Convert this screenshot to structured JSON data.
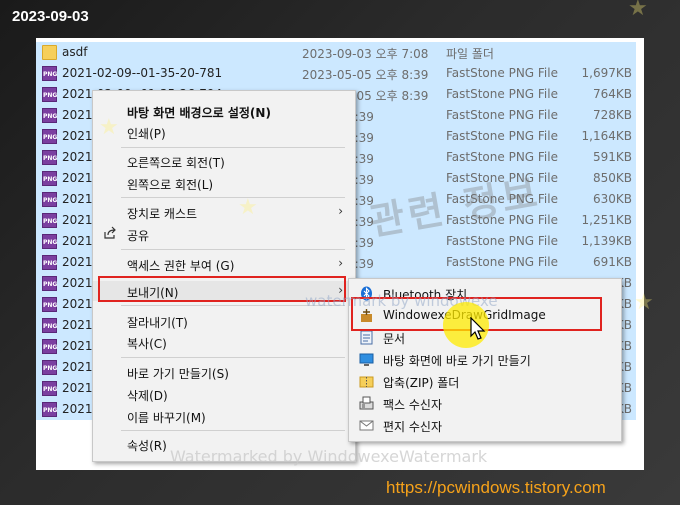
{
  "header_date": "2023-09-03",
  "url_text": "https://pcwindows.tistory.com",
  "watermark_big": "컴퓨터 관련 정보",
  "watermark_small": "watermark by windowexe",
  "watermark_bottom": "Watermarked by WindowexeWatermark",
  "files": [
    {
      "icon": "folder",
      "name": "asdf",
      "date": "2023-09-03 오후 7:08",
      "type": "파일 폴더",
      "size": ""
    },
    {
      "icon": "png",
      "name": "2021-02-09--01-35-20-781",
      "date": "2023-05-05 오후 8:39",
      "type": "FastStone PNG File",
      "size": "1,697KB"
    },
    {
      "icon": "png",
      "name": "2021-02-09--01-35-26-794",
      "date": "2023-05-05 오후 8:39",
      "type": "FastStone PNG File",
      "size": "764KB"
    },
    {
      "icon": "png",
      "name": "2021",
      "date": "05 오후 8:39",
      "type": "FastStone PNG File",
      "size": "728KB"
    },
    {
      "icon": "png",
      "name": "2021",
      "date": "05 오후 8:39",
      "type": "FastStone PNG File",
      "size": "1,164KB"
    },
    {
      "icon": "png",
      "name": "2021",
      "date": "05 오후 8:39",
      "type": "FastStone PNG File",
      "size": "591KB"
    },
    {
      "icon": "png",
      "name": "2021",
      "date": "05 오후 8:39",
      "type": "FastStone PNG File",
      "size": "850KB"
    },
    {
      "icon": "png",
      "name": "2021",
      "date": "05 오후 8:39",
      "type": "FastStone PNG File",
      "size": "630KB"
    },
    {
      "icon": "png",
      "name": "2021",
      "date": "05 오후 8:39",
      "type": "FastStone PNG File",
      "size": "1,251KB"
    },
    {
      "icon": "png",
      "name": "2021",
      "date": "05 오후 8:39",
      "type": "FastStone PNG File",
      "size": "1,139KB"
    },
    {
      "icon": "png",
      "name": "2021",
      "date": "05 오후 8:39",
      "type": "FastStone PNG File",
      "size": "691KB"
    },
    {
      "icon": "png",
      "name": "2021",
      "date": "",
      "type": "",
      "size": "KB"
    },
    {
      "icon": "png",
      "name": "2021",
      "date": "",
      "type": "",
      "size": "KB"
    },
    {
      "icon": "png",
      "name": "2021",
      "date": "",
      "type": "",
      "size": "KB"
    },
    {
      "icon": "png",
      "name": "2021",
      "date": "",
      "type": "",
      "size": "KB"
    },
    {
      "icon": "png",
      "name": "2021",
      "date": "",
      "type": "",
      "size": "KB"
    },
    {
      "icon": "png",
      "name": "2021",
      "date": "",
      "type": "",
      "size": "KB"
    },
    {
      "icon": "png",
      "name": "2021",
      "date": "",
      "type": "",
      "size": "KB"
    }
  ],
  "context_menu": {
    "set_background": "바탕 화면 배경으로 설정(N)",
    "print": "인쇄(P)",
    "rotate_right": "오른쪽으로 회전(T)",
    "rotate_left": "왼쪽으로 회전(L)",
    "cast_to_device": "장치로 캐스트",
    "share": "공유",
    "give_access": "액세스 권한 부여 (G)",
    "send_to": "보내기(N)",
    "cut": "잘라내기(T)",
    "copy": "복사(C)",
    "create_shortcut": "바로 가기 만들기(S)",
    "delete": "삭제(D)",
    "rename": "이름 바꾸기(M)",
    "properties": "속성(R)"
  },
  "send_to_menu": {
    "bluetooth": "Bluetooth 장치",
    "drawgrid": "WindowexeDrawGridImage",
    "documents": "문서",
    "desktop_shortcut": "바탕 화면에 바로 가기 만들기",
    "zip_folder": "압축(ZIP) 폴더",
    "fax": "팩스 수신자",
    "mail": "편지 수신자"
  },
  "colors": {
    "selection": "#cce8ff",
    "highlight_box": "#e0231f",
    "url": "#f6a21a",
    "png_icon": "#7b3fa0"
  }
}
